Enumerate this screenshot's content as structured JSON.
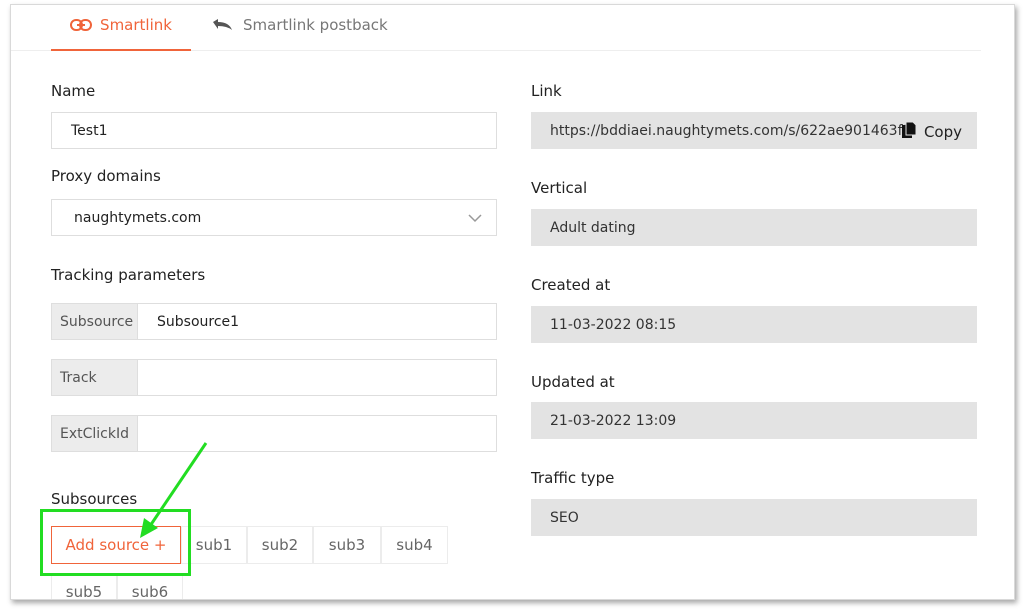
{
  "tabs": [
    {
      "label": "Smartlink",
      "icon": "link-icon",
      "active": true
    },
    {
      "label": "Smartlink postback",
      "icon": "undo-arrow-icon",
      "active": false
    }
  ],
  "left": {
    "name_label": "Name",
    "name_value": "Test1",
    "proxy_label": "Proxy domains",
    "proxy_value": "naughtymets.com",
    "tracking_label": "Tracking parameters",
    "params": [
      {
        "addon": "Subsource",
        "value": "Subsource1"
      },
      {
        "addon": "Track",
        "value": ""
      },
      {
        "addon": "ExtClickId",
        "value": ""
      }
    ],
    "subsources_label": "Subsources",
    "add_source_label": "Add source +",
    "chips": [
      "sub1",
      "sub2",
      "sub3",
      "sub4"
    ],
    "chips_row2": [
      "sub5",
      "sub6"
    ]
  },
  "right": {
    "link_label": "Link",
    "link_value": "https://bddiaei.naughtymets.com/s/622ae901463f1",
    "copy_label": "Copy",
    "vertical_label": "Vertical",
    "vertical_value": "Adult dating",
    "created_label": "Created at",
    "created_value": "11-03-2022 08:15",
    "updated_label": "Updated at",
    "updated_value": "21-03-2022 13:09",
    "traffic_label": "Traffic type",
    "traffic_value": "SEO"
  },
  "colors": {
    "accent": "#f0643a",
    "highlight": "#22dd22",
    "readonly_bg": "#e3e3e3"
  }
}
